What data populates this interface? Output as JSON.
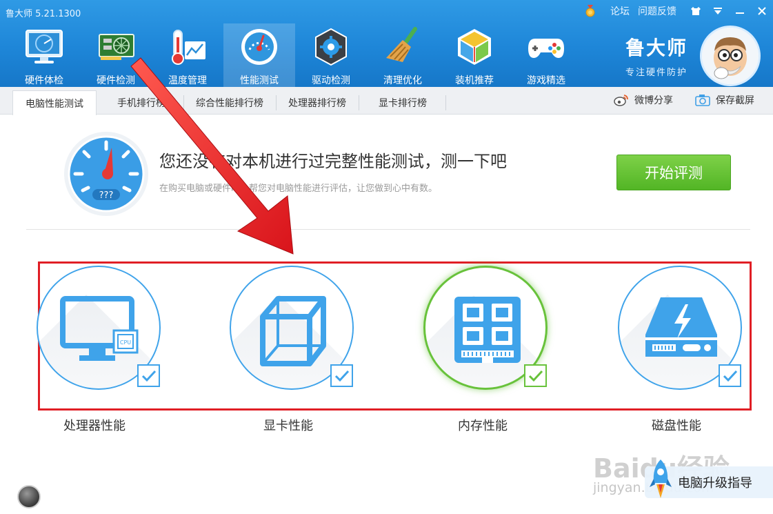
{
  "app": {
    "title": "鲁大师 5.21.1300"
  },
  "top_links": {
    "forum": "论坛",
    "feedback": "问题反馈"
  },
  "nav": [
    {
      "label": "硬件体检",
      "icon": "monitor-radar-icon"
    },
    {
      "label": "硬件检测",
      "icon": "graphics-card-icon"
    },
    {
      "label": "温度管理",
      "icon": "thermometer-icon"
    },
    {
      "label": "性能测试",
      "icon": "speedometer-icon"
    },
    {
      "label": "驱动检测",
      "icon": "driver-gear-icon"
    },
    {
      "label": "清理优化",
      "icon": "broom-icon"
    },
    {
      "label": "装机推荐",
      "icon": "box-icon"
    },
    {
      "label": "游戏精选",
      "icon": "gamepad-icon"
    }
  ],
  "brand": {
    "name": "鲁大师",
    "slogan": "专注硬件防护"
  },
  "tabs": [
    {
      "label": "电脑性能测试",
      "active": true
    },
    {
      "label": "手机排行榜",
      "active": false
    },
    {
      "label": "综合性能排行榜",
      "active": false
    },
    {
      "label": "处理器排行榜",
      "active": false
    },
    {
      "label": "显卡排行榜",
      "active": false
    }
  ],
  "tools": {
    "share": "微博分享",
    "screenshot": "保存截屏"
  },
  "test": {
    "gauge_text": "???",
    "headline": "您还没有对本机进行过完整性能测试，测一下吧",
    "description": "在购买电脑或硬件时，帮您对电脑性能进行评估，让您做到心中有数。",
    "start_button": "开始评测"
  },
  "perf_items": [
    {
      "label": "处理器性能",
      "icon": "cpu-monitor-icon",
      "checked": true,
      "cpu_tag": "CPU"
    },
    {
      "label": "显卡性能",
      "icon": "cube-icon",
      "checked": true
    },
    {
      "label": "内存性能",
      "icon": "memory-chip-icon",
      "checked": true,
      "selected": true
    },
    {
      "label": "磁盘性能",
      "icon": "disk-drive-icon",
      "checked": true
    }
  ],
  "bottom": {
    "upgrade_label": "电脑升级指导",
    "watermark": "Baidu经验",
    "watermark_url": "jingyan.baidu.com"
  },
  "colors": {
    "header_blue": "#1e86d8",
    "accent_blue": "#3fa3ea",
    "green": "#68c23b",
    "red_box": "#e01e25",
    "start_green": "#5cbf2e"
  }
}
